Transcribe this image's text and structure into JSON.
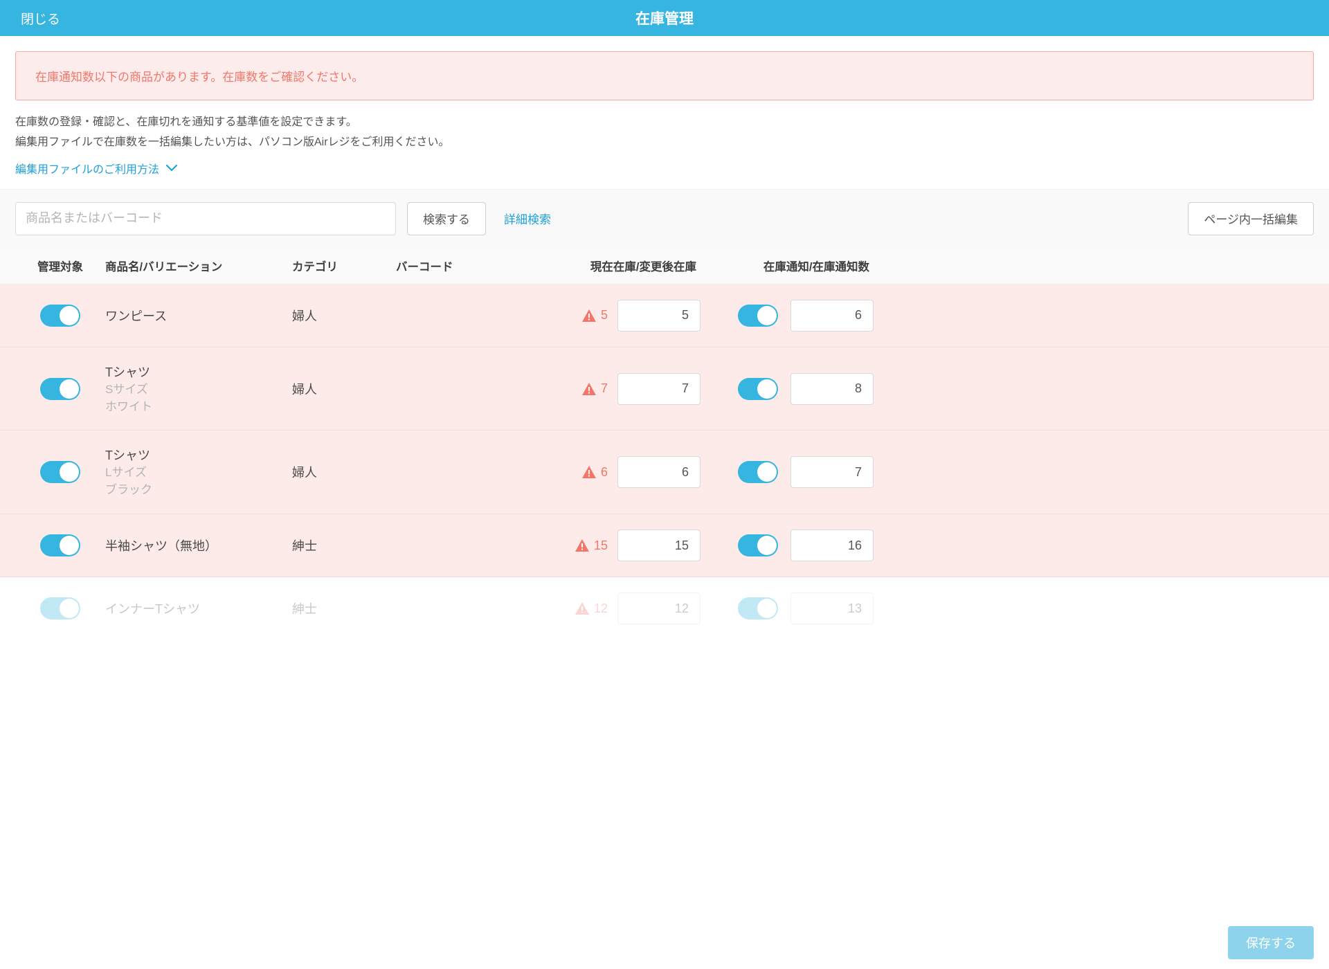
{
  "header": {
    "close_label": "閉じる",
    "title": "在庫管理"
  },
  "alert": {
    "message": "在庫通知数以下の商品があります。在庫数をご確認ください。"
  },
  "description": {
    "line1": "在庫数の登録・確認と、在庫切れを通知する基準値を設定できます。",
    "line2": "編集用ファイルで在庫数を一括編集したい方は、パソコン版Airレジをご利用ください。"
  },
  "help_link": {
    "label": "編集用ファイルのご利用方法"
  },
  "search": {
    "placeholder": "商品名またはバーコード",
    "button_label": "検索する",
    "advanced_label": "詳細検索",
    "bulk_edit_label": "ページ内一括編集"
  },
  "columns": {
    "managed": "管理対象",
    "product": "商品名/バリエーション",
    "category": "カテゴリ",
    "barcode": "バーコード",
    "stock": "現在在庫/変更後在庫",
    "threshold": "在庫通知/在庫通知数"
  },
  "rows": [
    {
      "managed_on": true,
      "name": "ワンピース",
      "variation": "",
      "category": "婦人",
      "barcode": "",
      "warn": true,
      "current_stock": "5",
      "stock_value": "5",
      "notify_on": true,
      "threshold_value": "6",
      "faded": false
    },
    {
      "managed_on": true,
      "name": "Tシャツ",
      "variation": "Sサイズ\nホワイト",
      "category": "婦人",
      "barcode": "",
      "warn": true,
      "current_stock": "7",
      "stock_value": "7",
      "notify_on": true,
      "threshold_value": "8",
      "faded": false
    },
    {
      "managed_on": true,
      "name": "Tシャツ",
      "variation": "Lサイズ\nブラック",
      "category": "婦人",
      "barcode": "",
      "warn": true,
      "current_stock": "6",
      "stock_value": "6",
      "notify_on": true,
      "threshold_value": "7",
      "faded": false
    },
    {
      "managed_on": true,
      "name": "半袖シャツ（無地）",
      "variation": "",
      "category": "紳士",
      "barcode": "",
      "warn": true,
      "current_stock": "15",
      "stock_value": "15",
      "notify_on": true,
      "threshold_value": "16",
      "faded": false
    },
    {
      "managed_on": true,
      "name": "インナーTシャツ",
      "variation": "",
      "category": "紳士",
      "barcode": "",
      "warn": true,
      "current_stock": "12",
      "stock_value": "12",
      "notify_on": true,
      "threshold_value": "13",
      "faded": true
    }
  ],
  "footer": {
    "save_label": "保存する"
  }
}
